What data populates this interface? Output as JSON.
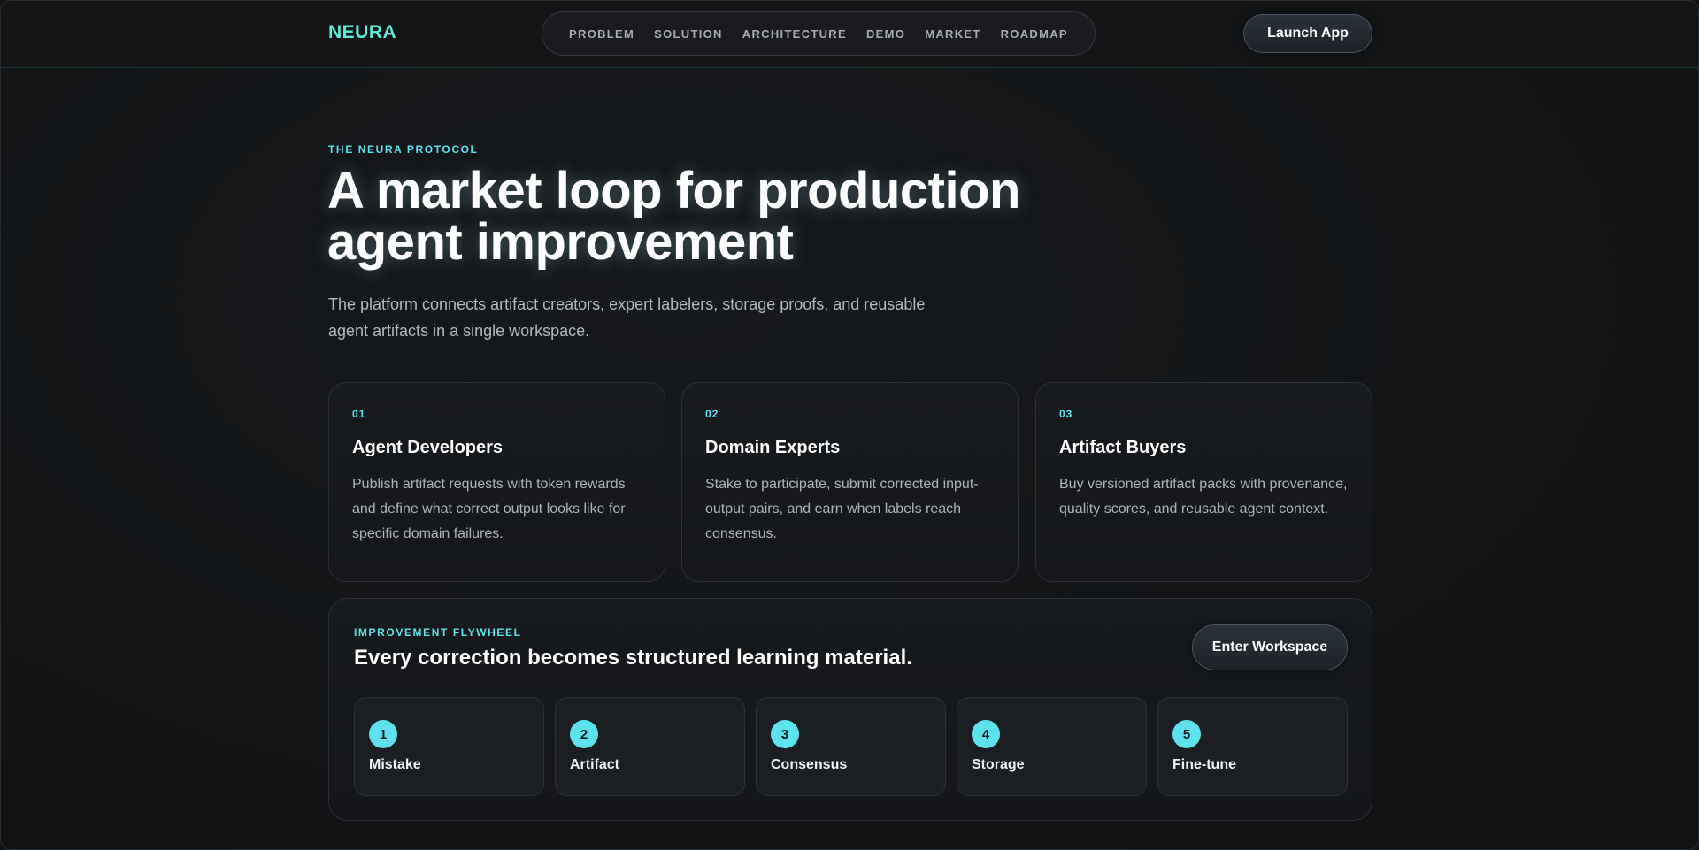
{
  "nav": {
    "logo": "NEURA",
    "links": [
      "PROBLEM",
      "SOLUTION",
      "ARCHITECTURE",
      "DEMO",
      "MARKET",
      "ROADMAP"
    ],
    "launch_label": "Launch App"
  },
  "hero": {
    "eyebrow": "THE NEURA PROTOCOL",
    "headline_line1": "A market loop for production",
    "headline_line2": "agent improvement",
    "subtitle": "The platform connects artifact creators, expert labelers, storage proofs, and reusable agent artifacts in a single workspace."
  },
  "cards": [
    {
      "num": "01",
      "title": "Agent Developers",
      "desc": "Publish artifact requests with token rewards and define what correct output looks like for specific domain failures."
    },
    {
      "num": "02",
      "title": "Domain Experts",
      "desc": "Stake to participate, submit corrected input-output pairs, and earn when labels reach consensus."
    },
    {
      "num": "03",
      "title": "Artifact Buyers",
      "desc": "Buy versioned artifact packs with provenance, quality scores, and reusable agent context."
    }
  ],
  "flywheel": {
    "eyebrow": "IMPROVEMENT FLYWHEEL",
    "title": "Every correction becomes structured learning material.",
    "enter_label": "Enter Workspace",
    "steps": [
      {
        "num": "1",
        "label": "Mistake"
      },
      {
        "num": "2",
        "label": "Artifact"
      },
      {
        "num": "3",
        "label": "Consensus"
      },
      {
        "num": "4",
        "label": "Storage"
      },
      {
        "num": "5",
        "label": "Fine-tune"
      }
    ]
  },
  "colors": {
    "accent": "#5ee3ee",
    "logo": "#5eead4",
    "background": "#111315"
  }
}
